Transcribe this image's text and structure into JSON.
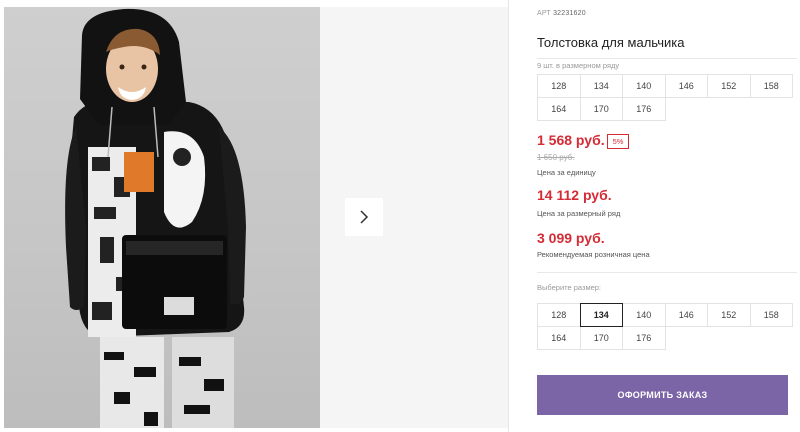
{
  "product": {
    "article_label": "АРТ",
    "article_number": "32231620",
    "title": "Толстовка для мальчика",
    "size_row_count": "9 шт. в размерном ряду"
  },
  "size_row": [
    "128",
    "134",
    "140",
    "146",
    "152",
    "158",
    "164",
    "170",
    "176"
  ],
  "pricing": {
    "unit_price": "1 568 руб.",
    "discount": "5%",
    "old_price": "1 650 руб.",
    "unit_caption": "Цена за единицу",
    "row_price": "14 112 руб.",
    "row_caption": "Цена за размерный ряд",
    "retail_price": "3 099 руб.",
    "retail_caption": "Рекомендуемая розничная цена"
  },
  "size_select": {
    "label": "Выберите размер:",
    "options": [
      "128",
      "134",
      "140",
      "146",
      "152",
      "158",
      "164",
      "170",
      "176"
    ],
    "selected": "134"
  },
  "order_button": "ОФОРМИТЬ ЗАКАЗ",
  "colors": {
    "accent": "#7b65a6",
    "price": "#d52b34"
  },
  "icons": {
    "next": "chevron-right-icon"
  }
}
